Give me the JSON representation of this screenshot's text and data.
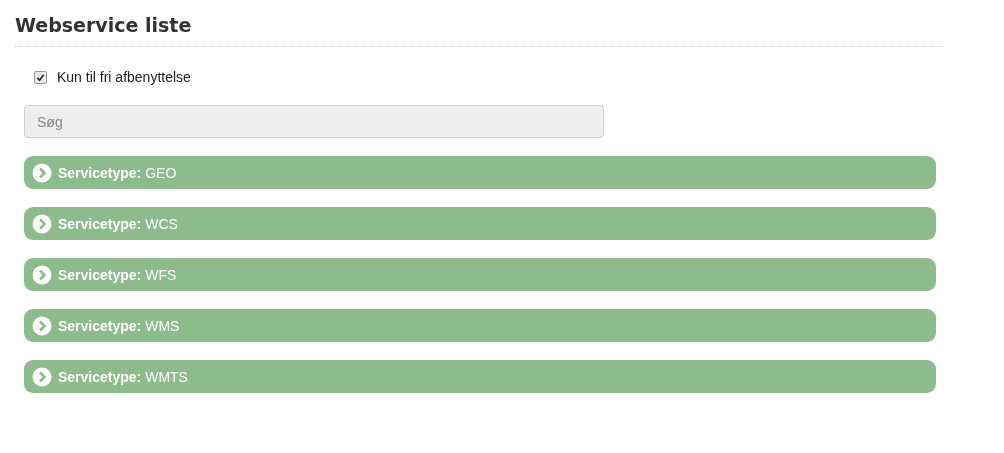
{
  "title": "Webservice liste",
  "filter": {
    "label": "Kun til fri afbenyttelse",
    "checked": true
  },
  "search": {
    "placeholder": "Søg"
  },
  "panels": [
    {
      "label": "**Servicetype:** GEO",
      "expanded": false
    },
    {
      "label": "**Servicetype:** WCS",
      "expanded": false
    },
    {
      "label": "**Servicetype:** WFS",
      "expanded": false
    },
    {
      "label": "**Servicetype:** WMS",
      "expanded": false
    },
    {
      "label": "**Servicetype:** WMTS",
      "expanded": false
    }
  ]
}
